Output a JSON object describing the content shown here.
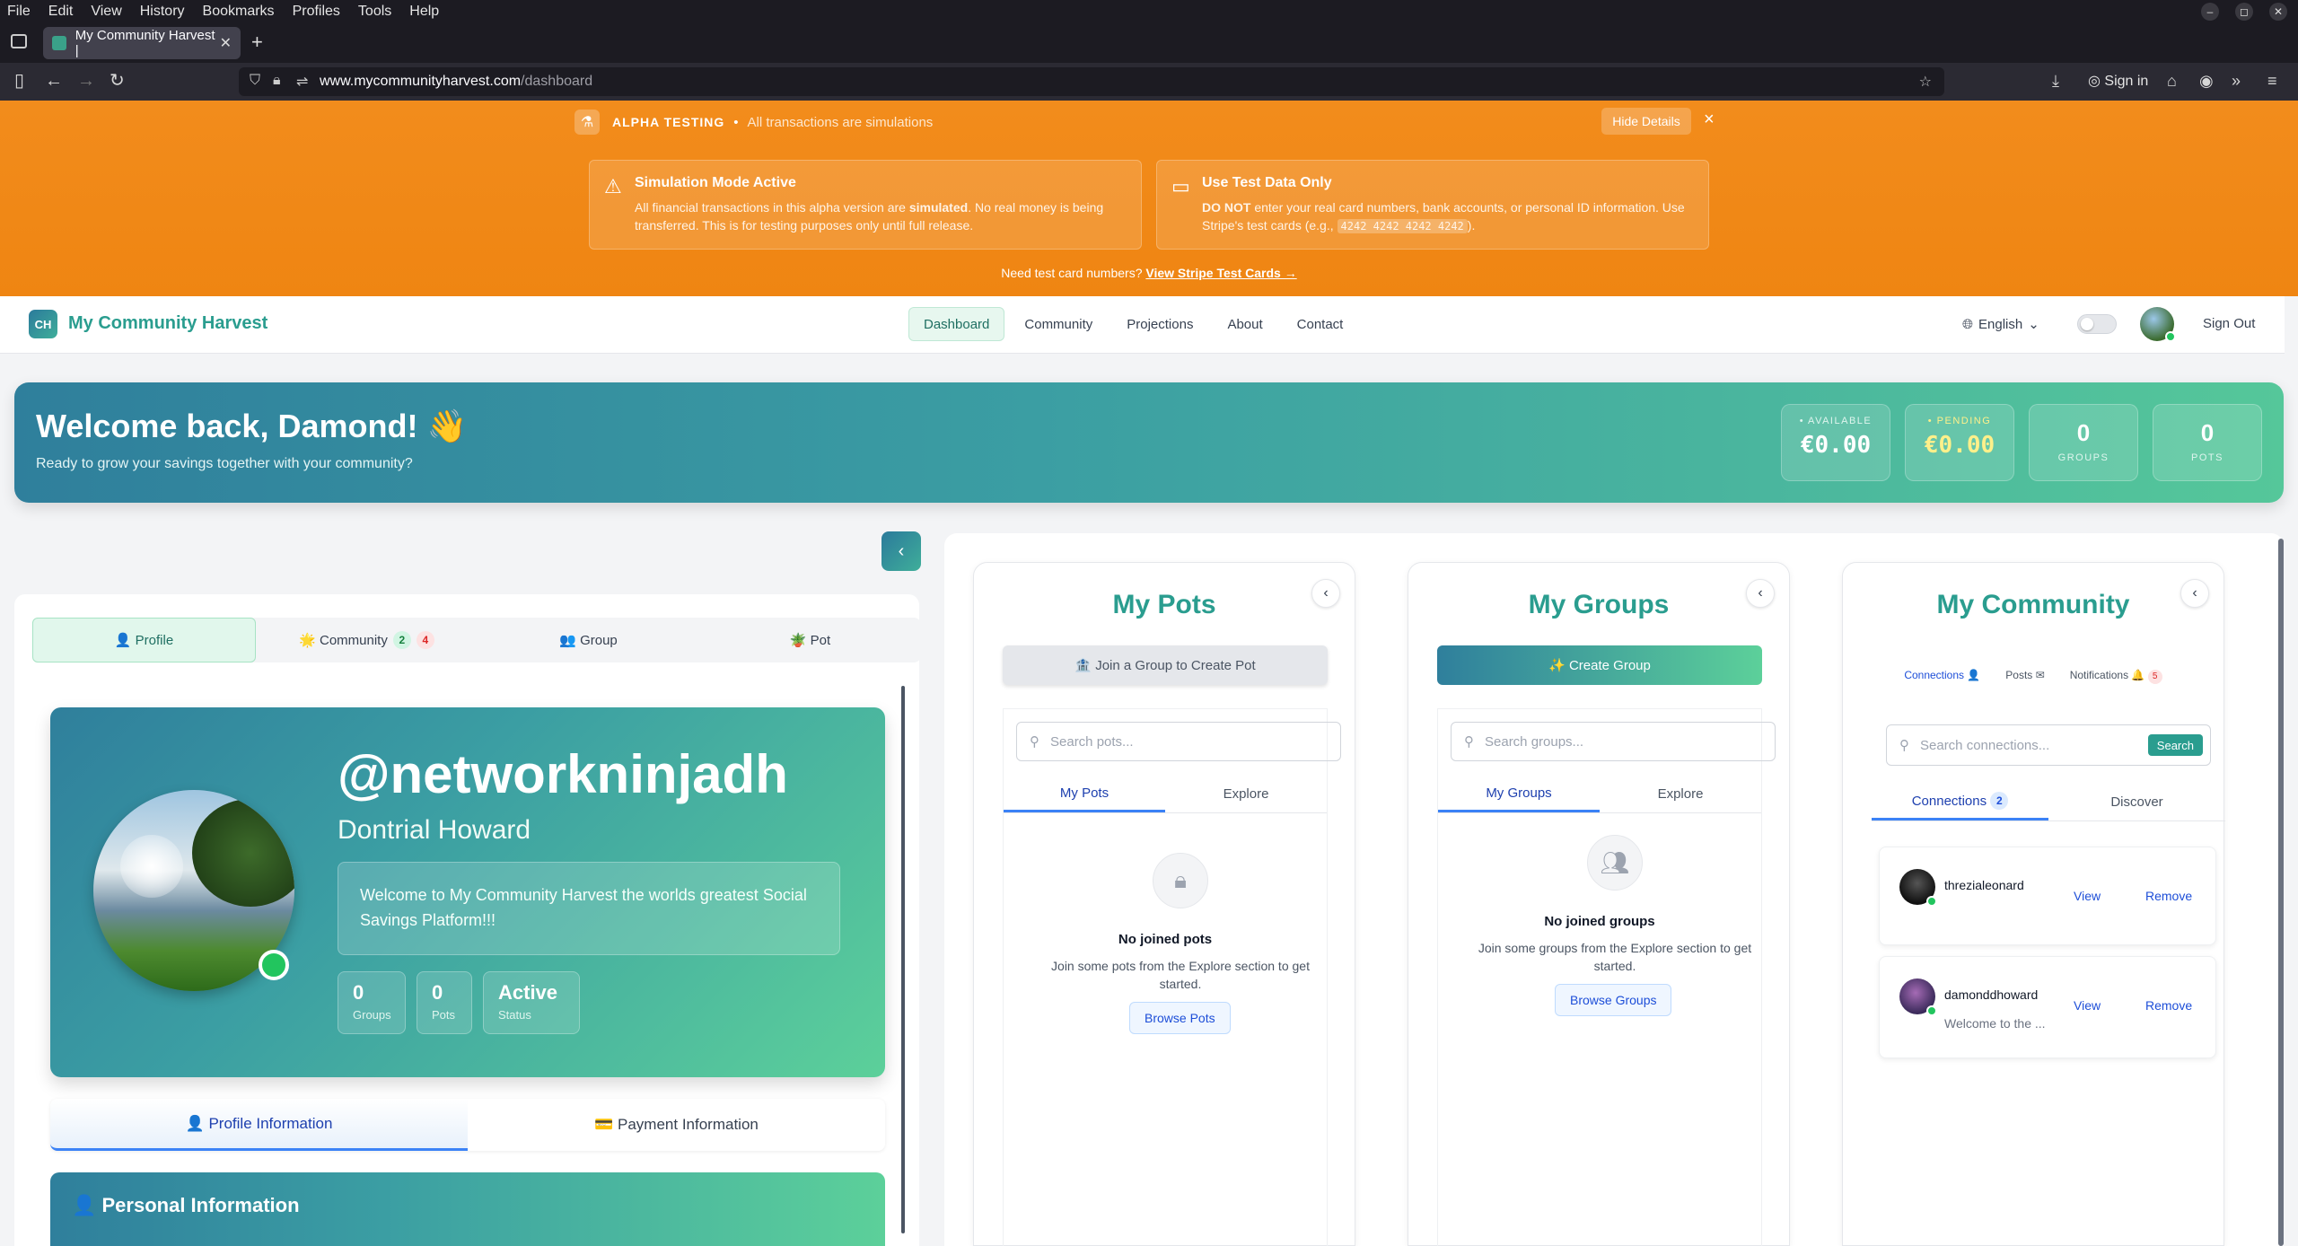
{
  "browser": {
    "menu": [
      "File",
      "Edit",
      "View",
      "History",
      "Bookmarks",
      "Profiles",
      "Tools",
      "Help"
    ],
    "tab_title": "My Community Harvest |",
    "url_domain": "www.mycommunityharvest.com",
    "url_path": "/dashboard",
    "sign_in": "Sign in"
  },
  "alpha": {
    "label": "ALPHA TESTING",
    "dot": "•",
    "tagline": "All transactions are simulations",
    "hide_details": "Hide Details",
    "close": "×",
    "card1": {
      "title": "Simulation Mode Active",
      "body_pre": "All financial transactions in this alpha version are ",
      "body_bold": "simulated",
      "body_post": ". No real money is being transferred. This is for testing purposes only until full release."
    },
    "card2": {
      "title": "Use Test Data Only",
      "body_bold": "DO NOT",
      "body_post": " enter your real card numbers, bank accounts, or personal ID information. Use Stripe's test cards (e.g., ",
      "code": "4242 4242 4242 4242",
      "tail": ")."
    },
    "footer_text": "Need test card numbers? ",
    "footer_link": "View Stripe Test Cards →"
  },
  "header": {
    "logo": "CH",
    "brand": "My Community Harvest",
    "nav": [
      "Dashboard",
      "Community",
      "Projections",
      "About",
      "Contact"
    ],
    "language": "English",
    "sign_out": "Sign Out"
  },
  "welcome": {
    "title": "Welcome back, Damond! 👋",
    "subtitle": "Ready to grow your savings together with your community?",
    "available_label": "• AVAILABLE",
    "available_value": "€0.00",
    "pending_label": "• PENDING",
    "pending_value": "€0.00",
    "groups_value": "0",
    "groups_label": "GROUPS",
    "pots_value": "0",
    "pots_label": "POTS"
  },
  "left": {
    "collapse": "‹",
    "tabs": {
      "profile": "👤 Profile",
      "community": "🌟 Community",
      "community_badge1": "2",
      "community_badge2": "4",
      "group": "👥 Group",
      "pot": "🪴 Pot"
    },
    "profile": {
      "handle": "@networkninjadh",
      "name": "Dontrial Howard",
      "bio": "Welcome to My Community Harvest the worlds greatest Social Savings Platform!!!",
      "groups_value": "0",
      "groups_label": "Groups",
      "pots_value": "0",
      "pots_label": "Pots",
      "status_value": "Active",
      "status_label": "Status"
    },
    "info_tabs": {
      "profile_info": "👤 Profile Information",
      "payment_info": "💳 Payment Information"
    },
    "personal_title": "👤 Personal Information"
  },
  "pots": {
    "title": "My Pots",
    "chevron": "‹",
    "action": "🏦 Join a Group to Create Pot",
    "search_placeholder": "Search pots...",
    "tab_mine": "My Pots",
    "tab_explore": "Explore",
    "empty_title": "No joined pots",
    "empty_text": "Join some pots from the Explore section to get started.",
    "browse": "Browse Pots"
  },
  "groups": {
    "title": "My Groups",
    "chevron": "‹",
    "action": "✨ Create Group",
    "search_placeholder": "Search groups...",
    "tab_mine": "My Groups",
    "tab_explore": "Explore",
    "empty_title": "No joined groups",
    "empty_text": "Join some groups from the Explore section to get started.",
    "browse": "Browse Groups"
  },
  "community": {
    "title": "My Community",
    "chevron": "‹",
    "tab_connections": "Connections 👤",
    "tab_posts": "Posts ✉",
    "tab_notifications": "Notifications 🔔",
    "notif_badge": "5",
    "search_placeholder": "Search connections...",
    "search_button": "Search",
    "sub_connections": "Connections",
    "sub_connections_count": "2",
    "sub_discover": "Discover",
    "connections": [
      {
        "name": "threzialeonard",
        "message": "",
        "view": "View",
        "remove": "Remove"
      },
      {
        "name": "damonddhoward",
        "message": "Welcome to the ...",
        "view": "View",
        "remove": "Remove"
      }
    ]
  },
  "colors": {
    "brand_teal": "#2a9d8f",
    "alpha_orange": "#f28c1c",
    "online_green": "#22c55e",
    "link_blue": "#1d4ed8"
  }
}
